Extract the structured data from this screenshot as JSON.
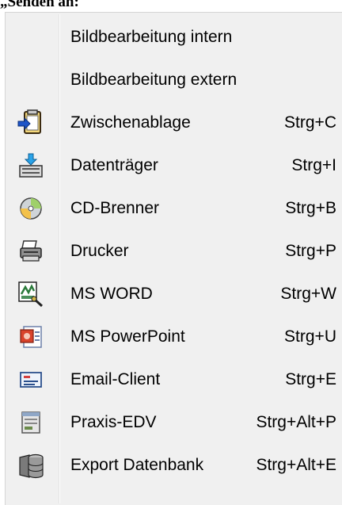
{
  "caption": "„Senden an:",
  "menu": {
    "items": [
      {
        "label": "Bildbearbeitung intern",
        "shortcut": "",
        "icon": ""
      },
      {
        "label": "Bildbearbeitung extern",
        "shortcut": "",
        "icon": ""
      },
      {
        "label": "Zwischenablage",
        "shortcut": "Strg+C",
        "icon": "clipboard-icon"
      },
      {
        "label": "Datenträger",
        "shortcut": "Strg+I",
        "icon": "drive-icon"
      },
      {
        "label": "CD-Brenner",
        "shortcut": "Strg+B",
        "icon": "cd-icon"
      },
      {
        "label": "Drucker",
        "shortcut": "Strg+P",
        "icon": "printer-icon"
      },
      {
        "label": "MS WORD",
        "shortcut": "Strg+W",
        "icon": "word-icon"
      },
      {
        "label": "MS PowerPoint",
        "shortcut": "Strg+U",
        "icon": "powerpoint-icon"
      },
      {
        "label": "Email-Client",
        "shortcut": "Strg+E",
        "icon": "email-icon"
      },
      {
        "label": "Praxis-EDV",
        "shortcut": "Strg+Alt+P",
        "icon": "practice-software-icon"
      },
      {
        "label": "Export Datenbank",
        "shortcut": "Strg+Alt+E",
        "icon": "database-icon"
      }
    ]
  }
}
